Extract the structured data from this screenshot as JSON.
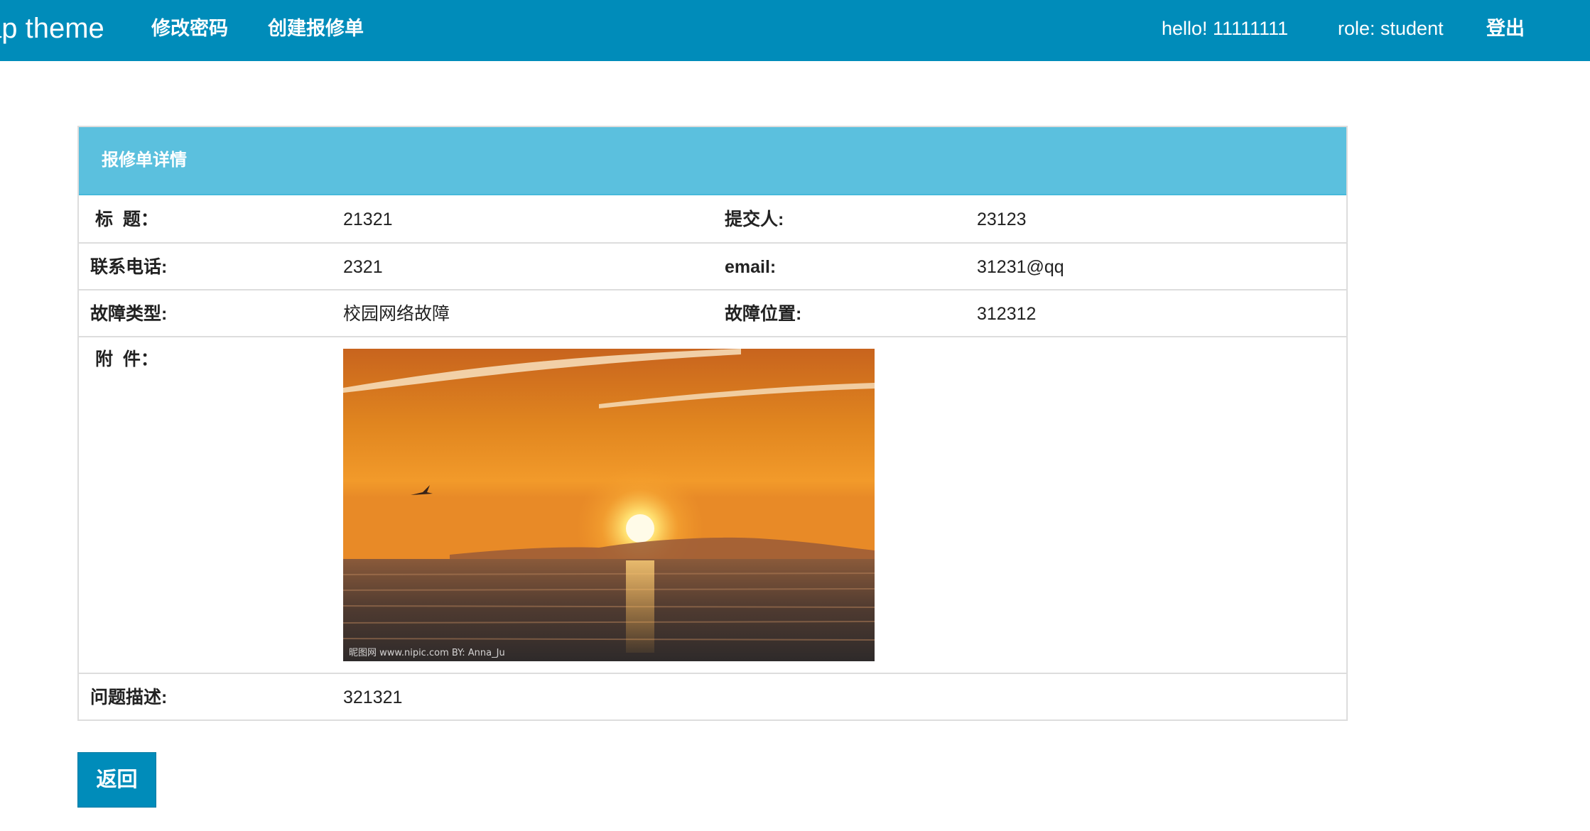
{
  "navbar": {
    "brand": "ap theme",
    "links": [
      "修改密码",
      "创建报修单"
    ],
    "greeting": "hello! 11111111",
    "role": "role: student",
    "logout": "登出"
  },
  "panel": {
    "title": "报修单详情",
    "rows": [
      {
        "label1": "标  题：",
        "value1": "21321",
        "label2": "提交人:",
        "value2": "23123"
      },
      {
        "label1": "联系电话:",
        "value1": "2321",
        "label2": "email:",
        "value2": "31231@qq"
      },
      {
        "label1": "故障类型:",
        "value1": "校园网络故障",
        "label2": "故障位置:",
        "value2": "312312"
      }
    ],
    "attachment": {
      "label": "附  件：",
      "image_description": "sunset-over-sea-photo",
      "watermark": "昵图网 www.nipic.com  BY: Anna_Ju"
    },
    "description": {
      "label": "问题描述:",
      "value": "321321"
    }
  },
  "back_button": "返回",
  "colors": {
    "navbar": "#008cba",
    "panel_heading": "#5bc0de",
    "button": "#008cba",
    "border": "#dddddd"
  }
}
